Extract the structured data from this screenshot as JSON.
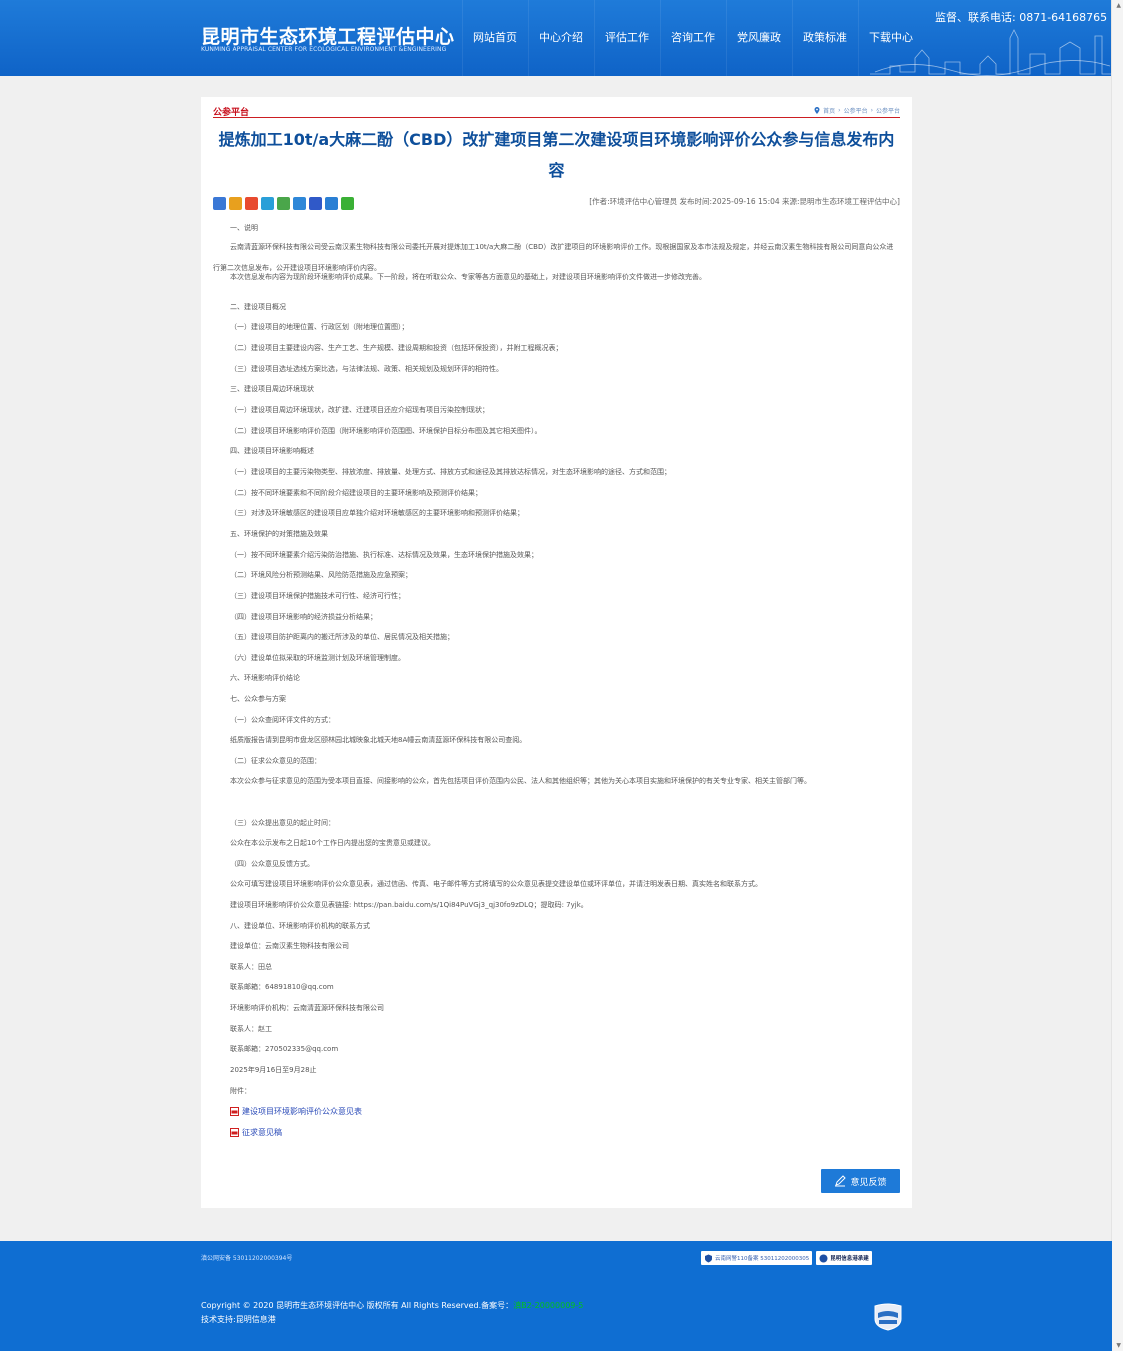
{
  "header": {
    "title_cn": "昆明市生态环境工程评估中心",
    "title_en": "KUNMING APPRAISAL CENTER FOR ECOLOGICAL ENVIRONMENT &ENGINEERING",
    "hotline": "监督、联系电话: 0871-64168765",
    "nav": [
      "网站首页",
      "中心介绍",
      "评估工作",
      "咨询工作",
      "党风廉政",
      "政策标准",
      "下载中心"
    ]
  },
  "page": {
    "section_label": "公参平台",
    "breadcrumb": [
      "首页",
      "公参平台",
      "公参平台"
    ],
    "title": "提炼加工10t/a大麻二酚（CBD）改扩建项目第二次建设项目环境影响评价公众参与信息发布内容",
    "meta": "[作者:环境评估中心管理员    发布时间:2025-09-16 15:04    来源:昆明市生态环境工程评估中心]",
    "share_icons": [
      "share-plus-icon",
      "qzone-icon",
      "weibo-icon",
      "tencent-weibo-icon",
      "douban-icon",
      "renren-icon",
      "baidu-icon",
      "info-icon",
      "wechat-icon"
    ],
    "share_colors": [
      "#3a78d6",
      "#e8a01e",
      "#e84a2f",
      "#2a9fd8",
      "#4aa64a",
      "#2e87d8",
      "#3059c8",
      "#2a7fd4",
      "#3ab035"
    ],
    "paragraphs": [
      "一、说明",
      "云南清蓝源环保科技有限公司受云南汉素生物科技有限公司委托开展对提炼加工10t/a大麻二酚（CBD）改扩建项目的环境影响评价工作。现根据国家及本市法规及规定，并经云南汉素生物科技有限公司同意向公众进行第二次信息发布，公开建设项目环境影响评价内容。",
      "本次信息发布内容为现阶段环境影响评价成果。下一阶段，将在听取公众、专家等各方面意见的基础上，对建设项目环境影响评价文件做进一步修改完善。",
      "二、建设项目概况",
      "（一）建设项目的地理位置、行政区划（附地理位置图）；",
      "（二）建设项目主要建设内容、生产工艺、生产规模、建设周期和投资（包括环保投资），并附工程概况表；",
      "（三）建设项目选址选线方案比选，与法律法规、政策、相关规划及规划环评的相符性。",
      "三、建设项目周边环境现状",
      "（一）建设项目周边环境现状，改扩建、迁建项目还应介绍现有项目污染控制现状；",
      "（二）建设项目环境影响评价范围（附环境影响评价范围图、环境保护目标分布图及其它相关图件）。",
      "四、建设项目环境影响概述",
      "（一）建设项目的主要污染物类型、排放浓度、排放量、处理方式、排放方式和途径及其排放达标情况，对生态环境影响的途径、方式和范围；",
      "（二）按不同环境要素和不同阶段介绍建设项目的主要环境影响及预测评价结果；",
      "（三）对涉及环境敏感区的建设项目应单独介绍对环境敏感区的主要环境影响和预测评价结果；",
      "五、环境保护的对策措施及效果",
      "（一）按不同环境要素介绍污染防治措施、执行标准、达标情况及效果，生态环境保护措施及效果；",
      "（二）环境风险分析预测结果、风险防范措施及应急预案；",
      "（三）建设项目环境保护措施技术可行性、经济可行性；",
      "（四）建设项目环境影响的经济损益分析结果；",
      "（五）建设项目防护距离内的搬迁所涉及的单位、居民情况及相关措施；",
      "（六）建设单位拟采取的环境监测计划及环境管理制度。",
      "六、环境影响评价结论",
      "七、公众参与方案",
      "（一）公众查阅环评文件的方式：",
      "纸质版报告请到昆明市盘龙区颐林园北城映象北城天地8A幢云南清蓝源环保科技有限公司查阅。",
      "（二）征求公众意见的范围：",
      "本次公众参与征求意见的范围为受本项目直接、间接影响的公众，首先包括项目评价范围内公民、法人和其他组织等；其他为关心本项目实施和环境保护的有关专业专家、相关主管部门等。",
      "（三）公众提出意见的起止时间：",
      "公众在本公示发布之日起10个工作日内提出您的宝贵意见或建议。",
      "（四）公众意见反馈方式。",
      "公众可填写建设项目环境影响评价公众意见表，通过信函、传真、电子邮件等方式将填写的公众意见表提交建设单位或环评单位，并请注明发表日期、真实姓名和联系方式。",
      "建设项目环境影响评价公众意见表链接: https://pan.baidu.com/s/1Qi84PuVGj3_qj30fo9zDLQ；提取码: 7yjk。",
      "八、建设单位、环境影响评价机构的联系方式",
      "建设单位：云南汉素生物科技有限公司",
      "联系人：田总",
      "联系邮箱：64891810@qq.com",
      "环境影响评价机构：云南清蓝源环保科技有限公司",
      "联系人：赵工",
      " 联系邮箱：270502335@qq.com",
      " 2025年9月16日至9月28止",
      " 附件："
    ],
    "attachments": [
      "建设项目环境影响评价公众意见表",
      "征求意见稿"
    ],
    "feedback_label": "意见反馈"
  },
  "footer": {
    "icp_police": "滇公网安备 53011202000394号",
    "badge_gov_label": "云南网警110备案 53011202000305",
    "badge_honest_label": "昆明信息港承建",
    "copyright": "Copyright © 2020 昆明市生态环境评估中心 版权所有 All Rights Reserved.备案号：",
    "icp_link": "滇B2-20000009-5",
    "tech_support": "技术支持:昆明信息港"
  },
  "colors": {
    "brand_blue": "#1473d7",
    "title_blue": "#0e4f9b",
    "accent_red": "#c8101d"
  }
}
